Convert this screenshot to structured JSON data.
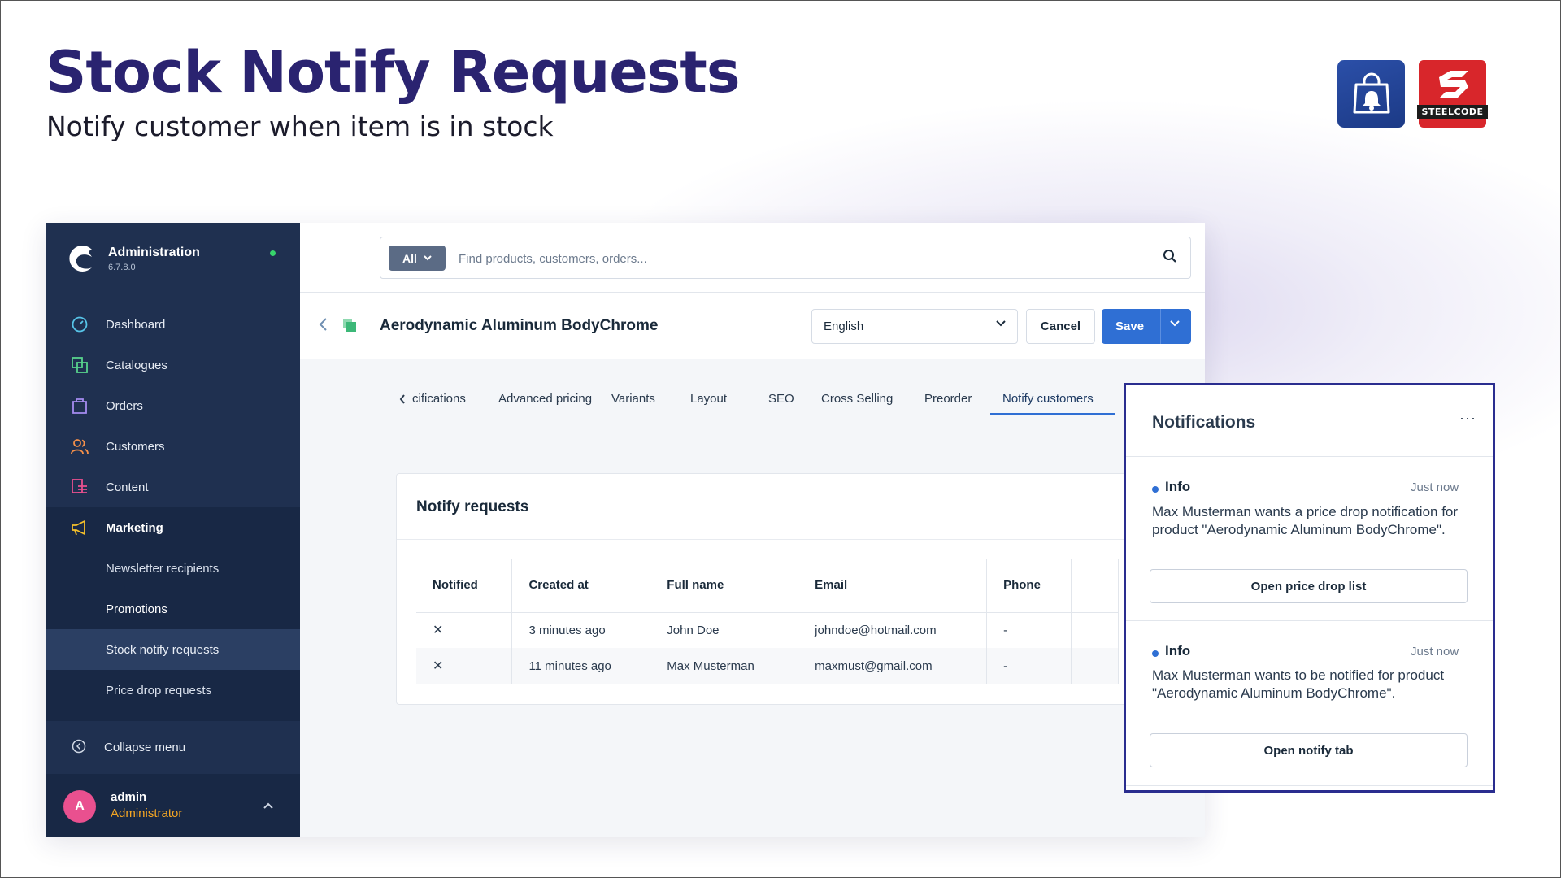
{
  "hero": {
    "title": "Stock Notify Requests",
    "subtitle": "Notify customer when item is in stock",
    "logos": [
      "shopping-bag-bell-icon",
      "steelcode-logo"
    ],
    "steelcode_word": "STEELCODE"
  },
  "sidebar": {
    "title": "Administration",
    "version": "6.7.8.0",
    "items": [
      {
        "label": "Dashboard",
        "icon": "dashboard-icon",
        "color": "#57c4e8"
      },
      {
        "label": "Catalogues",
        "icon": "catalogues-icon",
        "color": "#57d38c"
      },
      {
        "label": "Orders",
        "icon": "orders-icon",
        "color": "#a58bf0"
      },
      {
        "label": "Customers",
        "icon": "customers-icon",
        "color": "#f5904a"
      },
      {
        "label": "Content",
        "icon": "content-icon",
        "color": "#e9508f"
      },
      {
        "label": "Marketing",
        "icon": "marketing-icon",
        "color": "#f5c02a"
      }
    ],
    "sub_items": [
      {
        "label": "Newsletter recipients"
      },
      {
        "label": "Promotions"
      },
      {
        "label": "Stock notify requests"
      },
      {
        "label": "Price drop requests"
      }
    ],
    "collapse_label": "Collapse menu",
    "user": {
      "initial": "A",
      "name": "admin",
      "role": "Administrator"
    }
  },
  "search": {
    "scope": "All",
    "placeholder": "Find products, customers, orders..."
  },
  "page": {
    "product_title": "Aerodynamic Aluminum BodyChrome",
    "language": "English",
    "cancel_label": "Cancel",
    "save_label": "Save"
  },
  "tabs": [
    {
      "label": "cifications"
    },
    {
      "label": "Advanced pricing"
    },
    {
      "label": "Variants"
    },
    {
      "label": "Layout"
    },
    {
      "label": "SEO"
    },
    {
      "label": "Cross Selling"
    },
    {
      "label": "Preorder"
    },
    {
      "label": "Notify customers",
      "active": true
    }
  ],
  "notify_requests": {
    "title": "Notify requests",
    "columns": [
      "Notified",
      "Created at",
      "Full name",
      "Email",
      "Phone"
    ],
    "rows": [
      {
        "notified": "✕",
        "created_at": "3 minutes ago",
        "full_name": "John Doe",
        "email": "johndoe@hotmail.com",
        "phone": "-"
      },
      {
        "notified": "✕",
        "created_at": "11 minutes ago",
        "full_name": "Max Musterman",
        "email": "maxmust@gmail.com",
        "phone": "-"
      }
    ]
  },
  "notifications": {
    "title": "Notifications",
    "more": "···",
    "items": [
      {
        "type": "Info",
        "time": "Just now",
        "message": "Max Musterman wants a price drop notification for product \"Aerodynamic Aluminum BodyChrome\".",
        "action": "Open price drop list"
      },
      {
        "type": "Info",
        "time": "Just now",
        "message": "Max Musterman wants to be notified for product \"Aerodynamic Aluminum BodyChrome\".",
        "action": "Open notify tab"
      }
    ]
  },
  "colors": {
    "hero_title": "#2a2370",
    "sidebar_bg": "#1f3050",
    "primary": "#2f6fd4",
    "panel_border": "#2a2d8f",
    "error": "#e0343a",
    "role": "#f5a623"
  }
}
